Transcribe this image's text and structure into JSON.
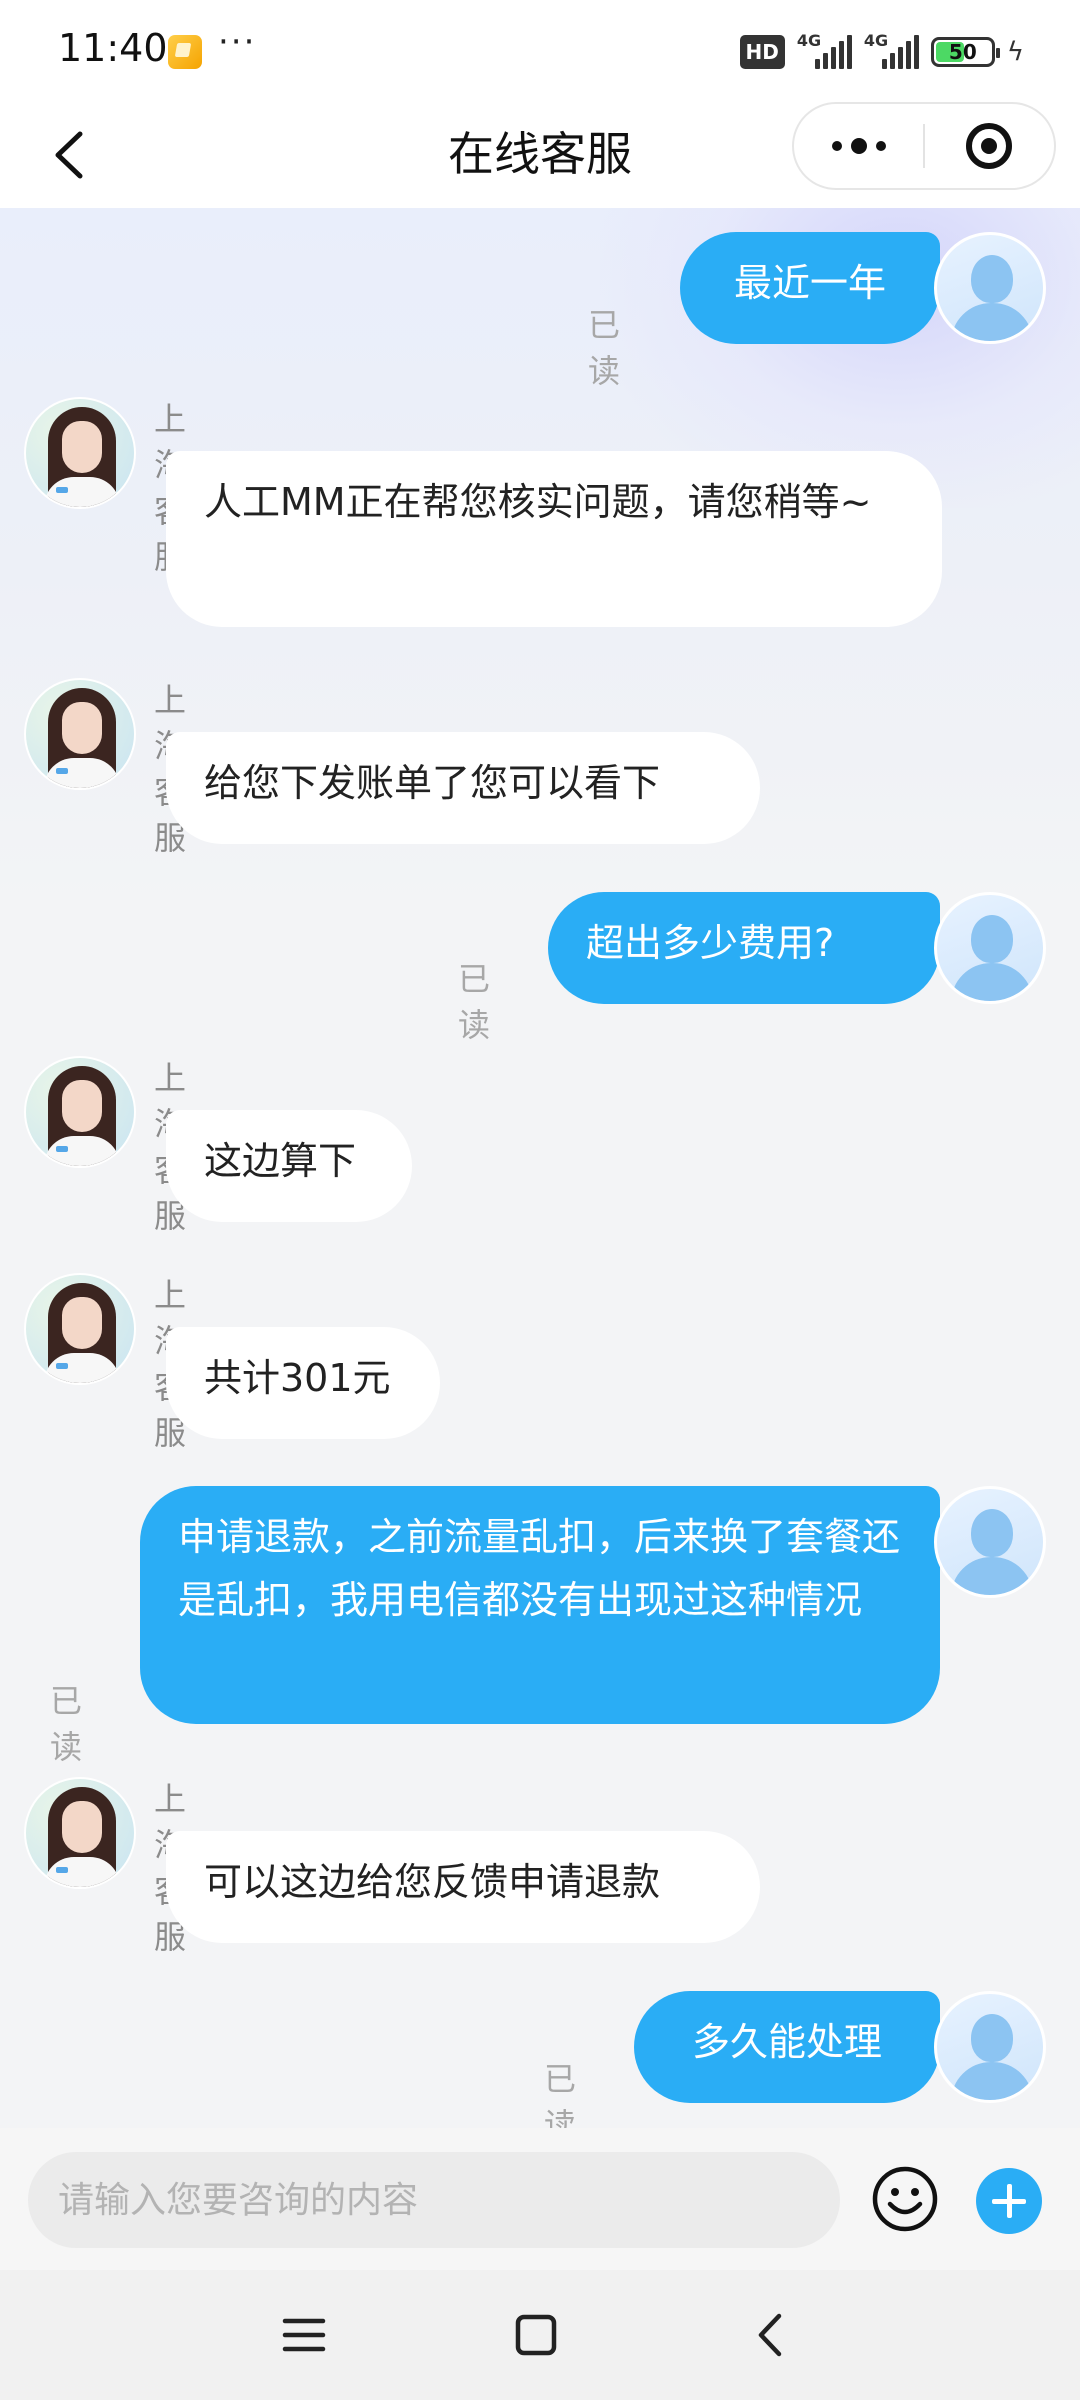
{
  "status_bar": {
    "time": "11:40",
    "more_dots": "···",
    "hd_label": "HD",
    "network1": "4G",
    "network2": "4G",
    "battery_level": "50",
    "battery_percent": 50
  },
  "nav": {
    "title": "在线客服"
  },
  "chat": {
    "messages": [
      {
        "direction": "out",
        "text": "最近一年",
        "read_label": "已读"
      },
      {
        "direction": "in",
        "sender": "上海客服",
        "text": "人工MM正在帮您核实问题，请您稍等~"
      },
      {
        "direction": "in",
        "sender": "上海客服",
        "text": "给您下发账单了您可以看下"
      },
      {
        "direction": "out",
        "text": "超出多少费用?",
        "read_label": "已读"
      },
      {
        "direction": "in",
        "sender": "上海客服",
        "text": "这边算下"
      },
      {
        "direction": "in",
        "sender": "上海客服",
        "text": "共计301元"
      },
      {
        "direction": "out",
        "text": "申请退款，之前流量乱扣，后来换了套餐还是乱扣，我用电信都没有出现过这种情况",
        "read_label": "已读"
      },
      {
        "direction": "in",
        "sender": "上海客服",
        "text": "可以这边给您反馈申请退款"
      },
      {
        "direction": "out",
        "text": "多久能处理",
        "read_label": "已读"
      }
    ]
  },
  "input": {
    "placeholder": "请输入您要咨询的内容",
    "value": ""
  },
  "icons": {
    "back": "chevron-left-icon",
    "more": "more-dots-icon",
    "close": "target-circle-icon",
    "emoji": "smiley-icon",
    "plus": "plus-icon",
    "sys_menu": "menu-lines-icon",
    "sys_home": "square-home-icon",
    "sys_back": "triangle-back-icon"
  },
  "colors": {
    "accent": "#2aadf5",
    "bubble_in": "#ffffff",
    "background": "#f3f4f6"
  }
}
